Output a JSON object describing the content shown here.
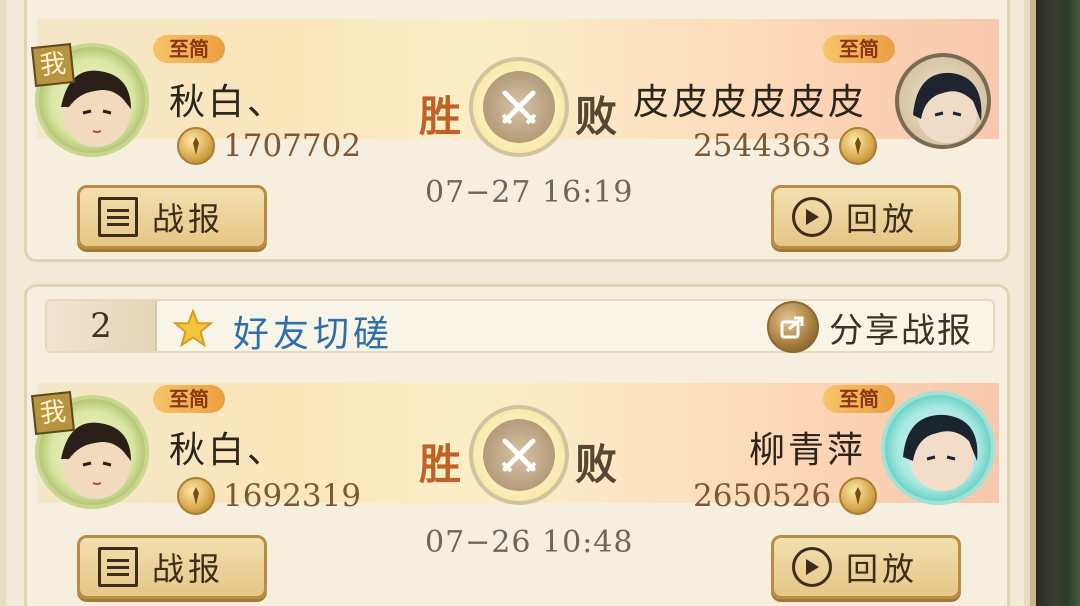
{
  "records": [
    {
      "left": {
        "me_badge": "我",
        "tag": "至简",
        "name": "秋白、",
        "power": "1707702"
      },
      "result_left": "胜",
      "result_right": "败",
      "time": "07−27 16:19",
      "right": {
        "tag": "至简",
        "name": "皮皮皮皮皮皮",
        "power": "2544363"
      },
      "report_label": "战报",
      "replay_label": "回放"
    },
    {
      "rank": "2",
      "title": "好友切磋",
      "share_label": "分享战报",
      "left": {
        "me_badge": "我",
        "tag": "至简",
        "name": "秋白、",
        "power": "1692319"
      },
      "result_left": "胜",
      "result_right": "败",
      "time": "07−26 10:48",
      "right": {
        "tag": "至简",
        "name": "柳青萍",
        "power": "2650526"
      },
      "report_label": "战报",
      "replay_label": "回放"
    }
  ],
  "colors": {
    "title_blue": "#2e6fa8",
    "win": "#c0612a",
    "accent_gold": "#e6c686"
  }
}
